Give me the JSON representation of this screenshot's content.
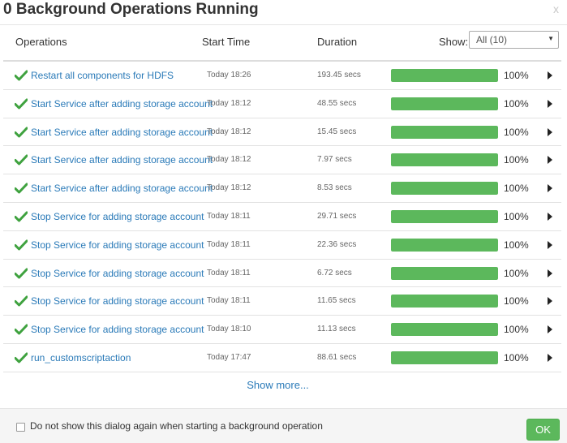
{
  "dialog": {
    "title": "0 Background Operations Running",
    "close_label": "x"
  },
  "header": {
    "operations": "Operations",
    "start_time": "Start Time",
    "duration": "Duration",
    "show_label": "Show:",
    "show_value": "All (10)"
  },
  "colors": {
    "link": "#2a7ab8",
    "success": "#5cb85c",
    "check": "#3fa23f"
  },
  "operations": [
    {
      "name": "Restart all components for HDFS",
      "start": "Today 18:26",
      "duration": "193.45 secs",
      "progress": 100,
      "progress_label": "100%",
      "status_icon": "check-icon"
    },
    {
      "name": "Start Service after adding storage account",
      "start": "Today 18:12",
      "duration": "48.55 secs",
      "progress": 100,
      "progress_label": "100%",
      "status_icon": "check-icon"
    },
    {
      "name": "Start Service after adding storage account",
      "start": "Today 18:12",
      "duration": "15.45 secs",
      "progress": 100,
      "progress_label": "100%",
      "status_icon": "check-icon"
    },
    {
      "name": "Start Service after adding storage account",
      "start": "Today 18:12",
      "duration": "7.97 secs",
      "progress": 100,
      "progress_label": "100%",
      "status_icon": "check-icon"
    },
    {
      "name": "Start Service after adding storage account",
      "start": "Today 18:12",
      "duration": "8.53 secs",
      "progress": 100,
      "progress_label": "100%",
      "status_icon": "check-icon"
    },
    {
      "name": "Stop Service for adding storage account",
      "start": "Today 18:11",
      "duration": "29.71 secs",
      "progress": 100,
      "progress_label": "100%",
      "status_icon": "check-icon"
    },
    {
      "name": "Stop Service for adding storage account",
      "start": "Today 18:11",
      "duration": "22.36 secs",
      "progress": 100,
      "progress_label": "100%",
      "status_icon": "check-icon"
    },
    {
      "name": "Stop Service for adding storage account",
      "start": "Today 18:11",
      "duration": "6.72 secs",
      "progress": 100,
      "progress_label": "100%",
      "status_icon": "check-icon"
    },
    {
      "name": "Stop Service for adding storage account",
      "start": "Today 18:11",
      "duration": "11.65 secs",
      "progress": 100,
      "progress_label": "100%",
      "status_icon": "check-icon"
    },
    {
      "name": "Stop Service for adding storage account",
      "start": "Today 18:10",
      "duration": "11.13 secs",
      "progress": 100,
      "progress_label": "100%",
      "status_icon": "check-icon"
    },
    {
      "name": "run_customscriptaction",
      "start": "Today 17:47",
      "duration": "88.61 secs",
      "progress": 100,
      "progress_label": "100%",
      "status_icon": "check-icon"
    }
  ],
  "show_more": "Show more...",
  "footer": {
    "checkbox_label": "Do not show this dialog again when starting a background operation",
    "checkbox_checked": false,
    "ok_label": "OK"
  }
}
